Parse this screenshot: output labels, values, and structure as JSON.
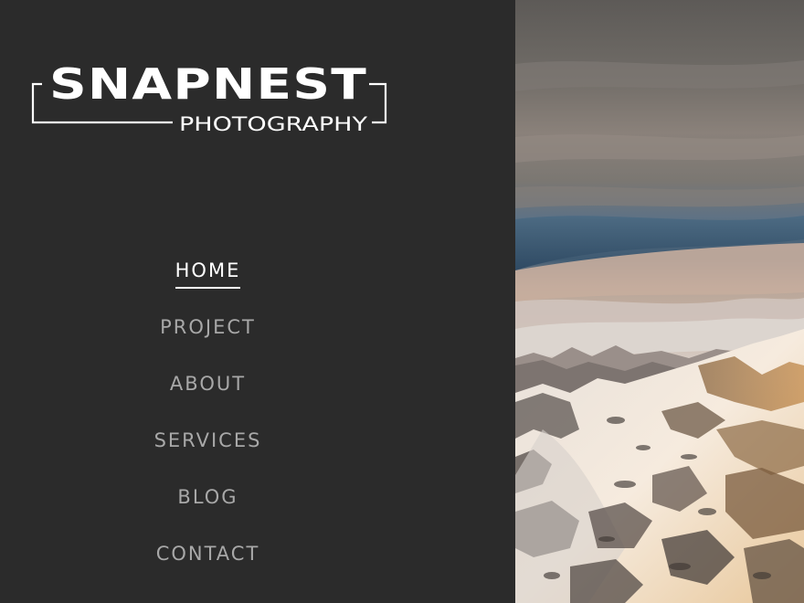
{
  "logo": {
    "title": "SNAPNEST",
    "subtitle": "PHOTOGRAPHY"
  },
  "nav": {
    "items": [
      {
        "label": "HOME",
        "active": true
      },
      {
        "label": "PROJECT",
        "active": false
      },
      {
        "label": "ABOUT",
        "active": false
      },
      {
        "label": "SERVICES",
        "active": false
      },
      {
        "label": "BLOG",
        "active": false
      },
      {
        "label": "CONTACT",
        "active": false
      }
    ]
  },
  "colors": {
    "sidebar_bg": "#2b2b2b",
    "nav_text": "#a8a8a8",
    "nav_active": "#ffffff"
  }
}
